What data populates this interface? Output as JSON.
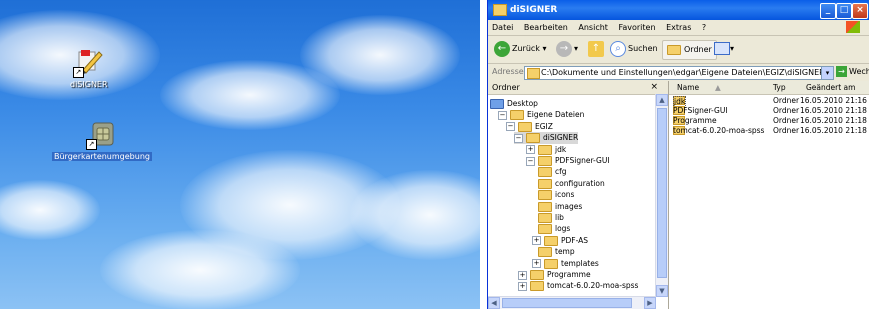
{
  "desktop": {
    "icons": [
      {
        "label": "diSIGNER",
        "selected": false
      },
      {
        "label": "Bürgerkartenumgebung",
        "selected": true
      }
    ]
  },
  "window": {
    "title": "diSIGNER",
    "menu": [
      "Datei",
      "Bearbeiten",
      "Ansicht",
      "Favoriten",
      "Extras",
      "?"
    ],
    "toolbar": {
      "back": "Zurück",
      "search": "Suchen",
      "folders": "Ordner"
    },
    "address": {
      "label": "Adresse",
      "value": "C:\\Dokumente und Einstellungen\\edgar\\Eigene Dateien\\EGIZ\\diSIGNER",
      "go": "Wechseln zu"
    },
    "tree": {
      "header": "Ordner",
      "close": "×",
      "items": [
        {
          "label": "Desktop",
          "exp": ""
        },
        {
          "label": "Eigene Dateien",
          "exp": "−"
        },
        {
          "label": "EGIZ",
          "exp": "−"
        },
        {
          "label": "diSIGNER",
          "exp": "−"
        },
        {
          "label": "jdk",
          "exp": "+"
        },
        {
          "label": "PDFSigner-GUI",
          "exp": "−"
        },
        {
          "label": "cfg",
          "exp": ""
        },
        {
          "label": "configuration",
          "exp": ""
        },
        {
          "label": "icons",
          "exp": ""
        },
        {
          "label": "images",
          "exp": ""
        },
        {
          "label": "lib",
          "exp": ""
        },
        {
          "label": "logs",
          "exp": ""
        },
        {
          "label": "PDF-AS",
          "exp": "+"
        },
        {
          "label": "temp",
          "exp": ""
        },
        {
          "label": "templates",
          "exp": "+"
        },
        {
          "label": "Programme",
          "exp": "+"
        },
        {
          "label": "tomcat-6.0.20-moa-spss",
          "exp": "+"
        }
      ]
    },
    "list": {
      "columns": [
        "Name",
        "Typ",
        "Geändert am"
      ],
      "rows": [
        {
          "name": "jdk",
          "type": "Ordner",
          "date": "16.05.2010 21:16"
        },
        {
          "name": "PDFSigner-GUI",
          "type": "Ordner",
          "date": "16.05.2010 21:18"
        },
        {
          "name": "Programme",
          "type": "Ordner",
          "date": "16.05.2010 21:18"
        },
        {
          "name": "tomcat-6.0.20-moa-spss",
          "type": "Ordner",
          "date": "16.05.2010 21:18"
        }
      ]
    }
  }
}
